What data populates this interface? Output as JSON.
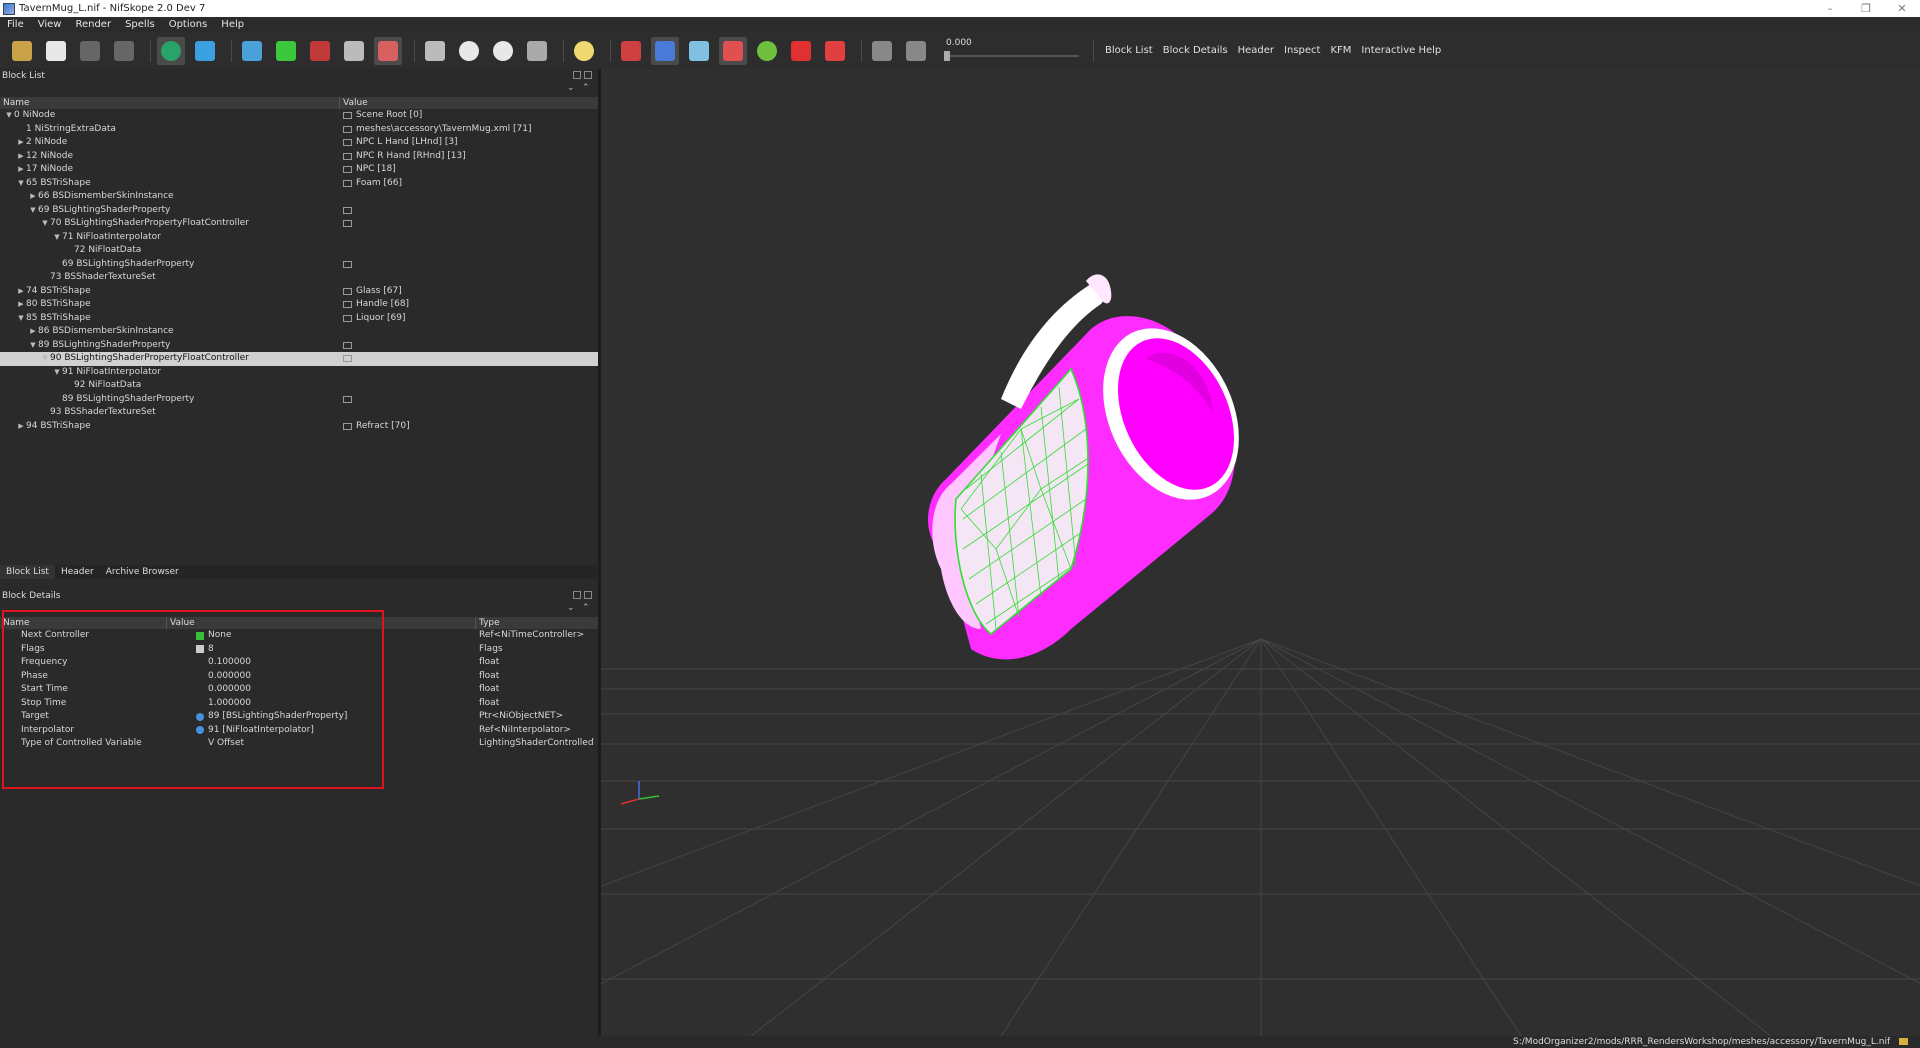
{
  "window": {
    "title": "TavernMug_L.nif - NifSkope 2.0 Dev 7"
  },
  "menu": [
    "File",
    "View",
    "Render",
    "Spells",
    "Options",
    "Help"
  ],
  "toolbar": {
    "icons": [
      {
        "name": "open-icon",
        "color": "#c9a24a"
      },
      {
        "name": "save-icon",
        "color": "#e8e8e8"
      },
      {
        "name": "undo-icon",
        "color": "#666666"
      },
      {
        "name": "redo-icon",
        "color": "#666666"
      },
      {
        "name": "sep"
      },
      {
        "name": "select-object-icon",
        "color": "#29a36a",
        "active": true
      },
      {
        "name": "select-vertex-icon",
        "color": "#3aa0e0"
      },
      {
        "name": "sep"
      },
      {
        "name": "view-top-icon",
        "color": "#4aa0d8"
      },
      {
        "name": "view-front-icon",
        "color": "#3cc83c"
      },
      {
        "name": "view-side-icon",
        "color": "#c03a3a"
      },
      {
        "name": "view-flip-icon",
        "color": "#bbbbbb"
      },
      {
        "name": "view-perspective-icon",
        "color": "#d86060",
        "active": true
      },
      {
        "name": "sep"
      },
      {
        "name": "walk-icon",
        "color": "#bbbbbb"
      },
      {
        "name": "eye-icon",
        "color": "#e8e8e8"
      },
      {
        "name": "eye-alt-icon",
        "color": "#e8e8e8"
      },
      {
        "name": "screenshot-icon",
        "color": "#aaaaaa"
      },
      {
        "name": "sep"
      },
      {
        "name": "lightbulb-icon",
        "color": "#f0d870"
      },
      {
        "name": "sep"
      },
      {
        "name": "axes-red-icon",
        "color": "#d04040"
      },
      {
        "name": "axes-icon",
        "color": "#4a7ad8",
        "active": true
      },
      {
        "name": "nodes-icon",
        "color": "#80c0e0"
      },
      {
        "name": "texture-icon",
        "color": "#e05050",
        "active": true
      },
      {
        "name": "green-circle-icon",
        "color": "#70c040"
      },
      {
        "name": "marker-icon",
        "color": "#e03030"
      },
      {
        "name": "collision-icon",
        "color": "#e04040"
      },
      {
        "name": "sep"
      },
      {
        "name": "play-icon",
        "color": "#888888"
      },
      {
        "name": "loop-icon",
        "color": "#888888"
      }
    ],
    "time_value": "0.000",
    "view_buttons": [
      "Block List",
      "Block Details",
      "Header",
      "Inspect",
      "KFM",
      "Interactive Help"
    ]
  },
  "block_list": {
    "title": "Block List",
    "columns": [
      "Name",
      "Value"
    ],
    "rows": [
      {
        "name": "0 NiNode",
        "value": "Scene Root [0]",
        "indent": 0,
        "expand": "open",
        "icon": true
      },
      {
        "name": "1 NiStringExtraData",
        "value": "meshes\\accessory\\TavernMug.xml [71]",
        "indent": 1,
        "expand": "none",
        "icon": true
      },
      {
        "name": "2 NiNode",
        "value": "NPC L Hand [LHnd] [3]",
        "indent": 1,
        "expand": "closed",
        "icon": true
      },
      {
        "name": "12 NiNode",
        "value": "NPC R Hand [RHnd] [13]",
        "indent": 1,
        "expand": "closed",
        "icon": true
      },
      {
        "name": "17 NiNode",
        "value": "NPC [18]",
        "indent": 1,
        "expand": "closed",
        "icon": true
      },
      {
        "name": "65 BSTriShape",
        "value": "Foam [66]",
        "indent": 1,
        "expand": "open",
        "icon": true
      },
      {
        "name": "66 BSDismemberSkinInstance",
        "value": "",
        "indent": 2,
        "expand": "closed",
        "icon": false
      },
      {
        "name": "69 BSLightingShaderProperty",
        "value": "",
        "indent": 2,
        "expand": "open",
        "icon": true
      },
      {
        "name": "70 BSLightingShaderPropertyFloatController",
        "value": "",
        "indent": 3,
        "expand": "open",
        "icon": true
      },
      {
        "name": "71 NiFloatInterpolator",
        "value": "",
        "indent": 4,
        "expand": "open",
        "icon": false
      },
      {
        "name": "72 NiFloatData",
        "value": "",
        "indent": 5,
        "expand": "none",
        "icon": false
      },
      {
        "name": "69 BSLightingShaderProperty",
        "value": "",
        "indent": 4,
        "expand": "none",
        "icon": true
      },
      {
        "name": "73 BSShaderTextureSet",
        "value": "",
        "indent": 3,
        "expand": "none",
        "icon": false
      },
      {
        "name": "74 BSTriShape",
        "value": "Glass [67]",
        "indent": 1,
        "expand": "closed",
        "icon": true
      },
      {
        "name": "80 BSTriShape",
        "value": "Handle [68]",
        "indent": 1,
        "expand": "closed",
        "icon": true
      },
      {
        "name": "85 BSTriShape",
        "value": "Liquor [69]",
        "indent": 1,
        "expand": "open",
        "icon": true
      },
      {
        "name": "86 BSDismemberSkinInstance",
        "value": "",
        "indent": 2,
        "expand": "closed",
        "icon": false
      },
      {
        "name": "89 BSLightingShaderProperty",
        "value": "",
        "indent": 2,
        "expand": "open",
        "icon": true
      },
      {
        "name": "90 BSLightingShaderPropertyFloatController",
        "value": "",
        "indent": 3,
        "expand": "open",
        "icon": true,
        "selected": true
      },
      {
        "name": "91 NiFloatInterpolator",
        "value": "",
        "indent": 4,
        "expand": "open",
        "icon": false
      },
      {
        "name": "92 NiFloatData",
        "value": "",
        "indent": 5,
        "expand": "none",
        "icon": false
      },
      {
        "name": "89 BSLightingShaderProperty",
        "value": "",
        "indent": 4,
        "expand": "none",
        "icon": true
      },
      {
        "name": "93 BSShaderTextureSet",
        "value": "",
        "indent": 3,
        "expand": "none",
        "icon": false
      },
      {
        "name": "94 BSTriShape",
        "value": "Refract [70]",
        "indent": 1,
        "expand": "closed",
        "icon": true
      }
    ]
  },
  "tabs": [
    {
      "label": "Block List",
      "active": true
    },
    {
      "label": "Header",
      "active": false
    },
    {
      "label": "Archive Browser",
      "active": false
    }
  ],
  "block_details": {
    "title": "Block Details",
    "columns": [
      "Name",
      "Value",
      "Type"
    ],
    "rows": [
      {
        "name": "Next Controller",
        "value": "None",
        "type": "Ref<NiTimeController>",
        "icon": "green-plus-icon"
      },
      {
        "name": "Flags",
        "value": "8",
        "type": "Flags",
        "icon": "flags-icon"
      },
      {
        "name": "Frequency",
        "value": "0.100000",
        "type": "float",
        "icon": ""
      },
      {
        "name": "Phase",
        "value": "0.000000",
        "type": "float",
        "icon": ""
      },
      {
        "name": "Start Time",
        "value": "0.000000",
        "type": "float",
        "icon": ""
      },
      {
        "name": "Stop Time",
        "value": "1.000000",
        "type": "float",
        "icon": ""
      },
      {
        "name": "Target",
        "value": "89 [BSLightingShaderProperty]",
        "type": "Ptr<NiObjectNET>",
        "icon": "link-icon"
      },
      {
        "name": "Interpolator",
        "value": "91 [NiFloatInterpolator]",
        "type": "Ref<NiInterpolator>",
        "icon": "link-icon"
      },
      {
        "name": "Type of Controlled Variable",
        "value": "V Offset",
        "type": "LightingShaderControlledVariable",
        "icon": ""
      }
    ]
  },
  "status": {
    "path": "S:/ModOrganizer2/mods/RRR_RendersWorkshop/meshes/accessory/TavernMug_L.nif"
  },
  "colors": {
    "mug_magenta": "#ff00ff",
    "wireframe": "#33dd33",
    "selection": "#d0d0d0",
    "highlight_box": "#e0141e"
  }
}
